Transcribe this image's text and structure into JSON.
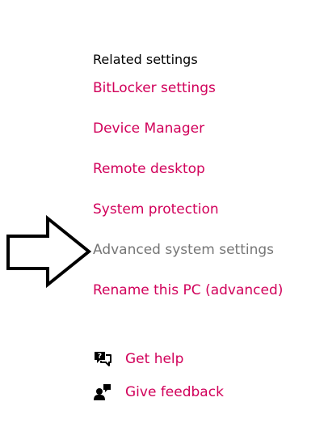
{
  "related_settings": {
    "heading": "Related settings",
    "links": [
      {
        "label": "BitLocker settings"
      },
      {
        "label": "Device Manager"
      },
      {
        "label": "Remote desktop"
      },
      {
        "label": "System protection"
      },
      {
        "label": "Advanced system settings",
        "state": "hovered"
      },
      {
        "label": "Rename this PC (advanced)"
      }
    ]
  },
  "support": {
    "get_help": {
      "label": "Get help",
      "icon": "help-chat-icon"
    },
    "give_feedback": {
      "label": "Give feedback",
      "icon": "feedback-person-icon"
    }
  },
  "annotation": {
    "icon": "right-arrow-outline"
  },
  "colors": {
    "link": "#d1005a",
    "link_hover": "#767676",
    "text": "#000000",
    "background": "#ffffff"
  }
}
